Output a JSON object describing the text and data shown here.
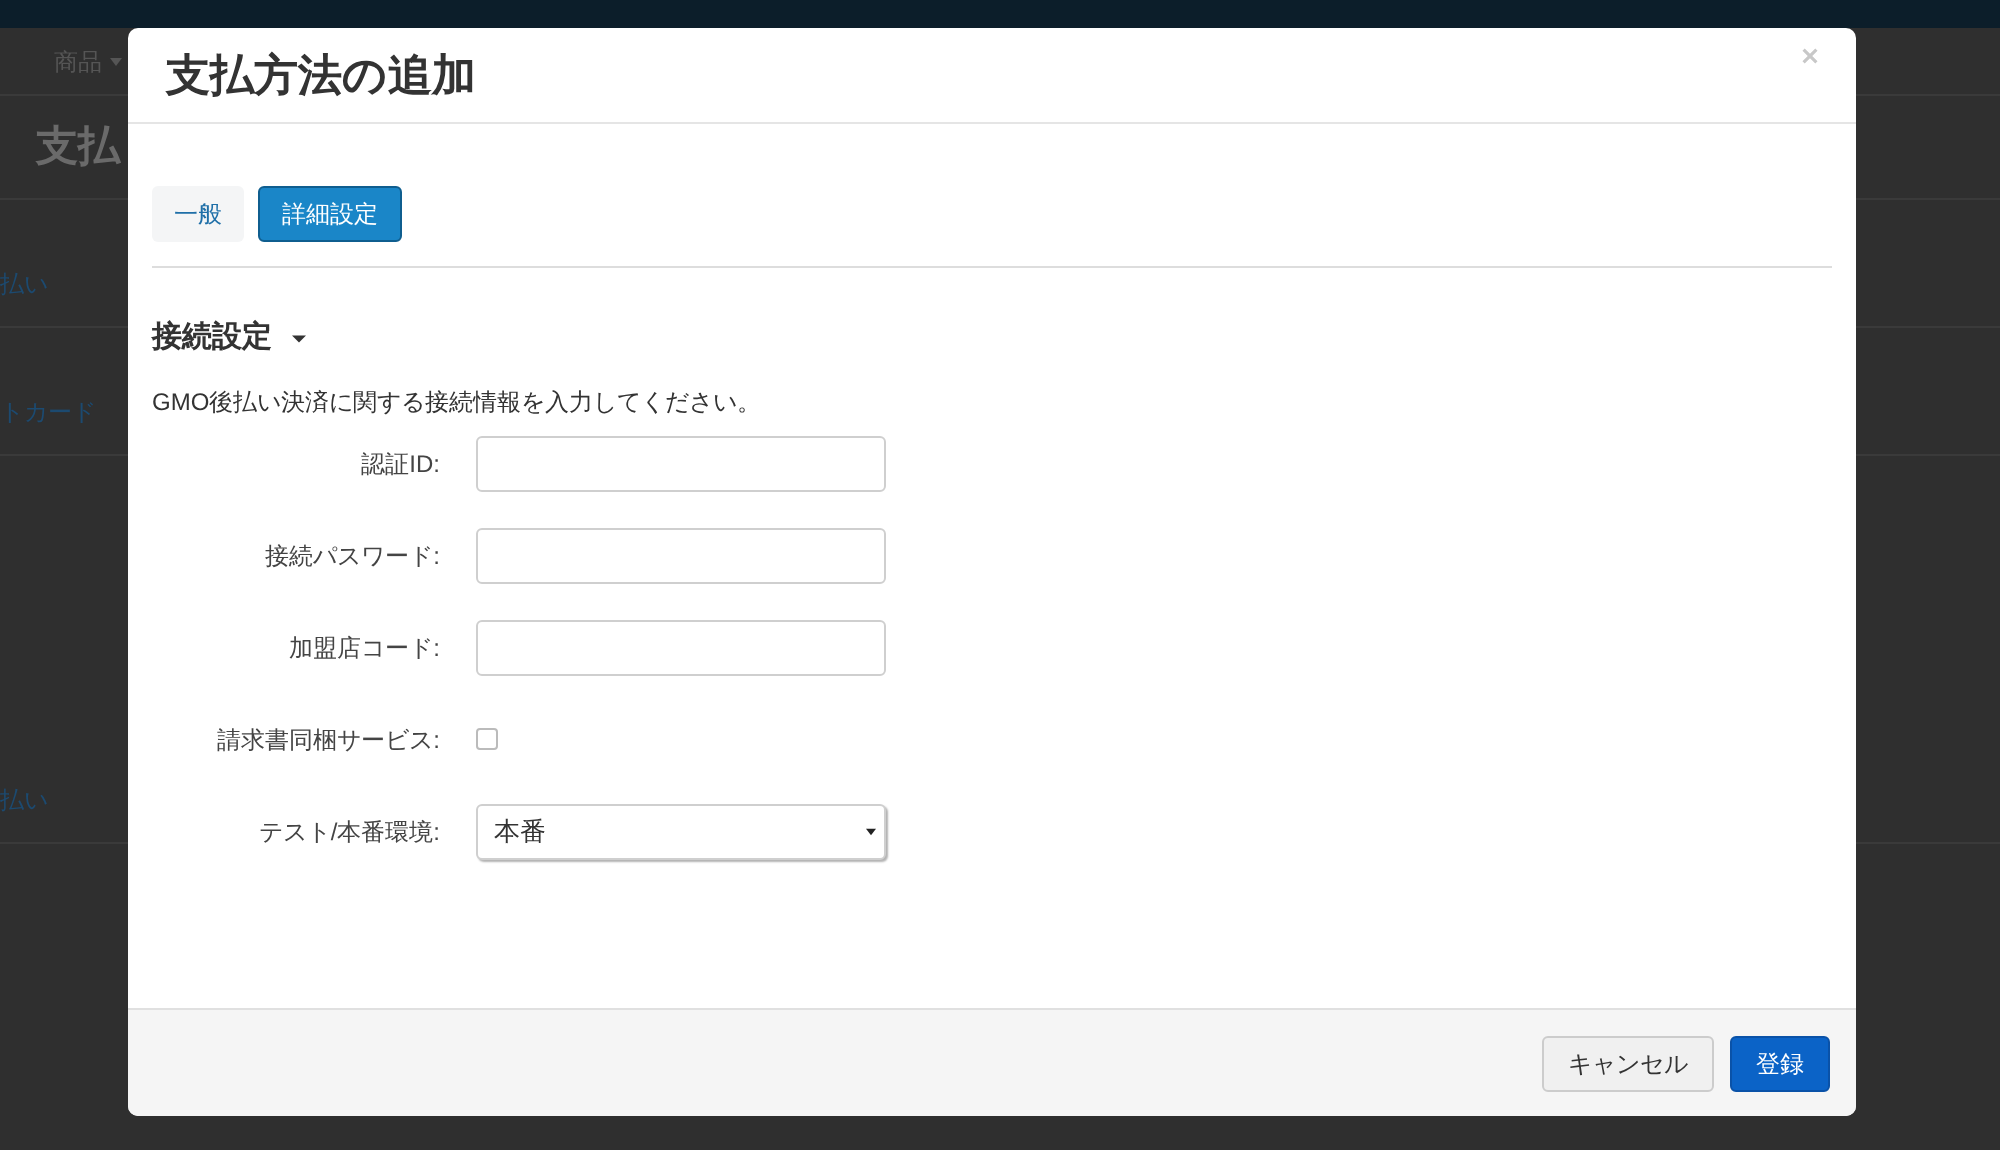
{
  "background": {
    "nav_item": "商品",
    "page_title": "支払",
    "list_items": [
      "払い",
      "トカード",
      "払い"
    ]
  },
  "dialog": {
    "title": "支払方法の追加",
    "tabs": [
      {
        "label": "一般",
        "selected": false
      },
      {
        "label": "詳細設定",
        "selected": true
      }
    ],
    "section": {
      "title": "接続設定",
      "expanded": true,
      "description": "GMO後払い決済に関する接続情報を入力してください。"
    },
    "fields": [
      {
        "kind": "text",
        "label": "認証ID:"
      },
      {
        "kind": "text",
        "label": "接続パスワード:"
      },
      {
        "kind": "text",
        "label": "加盟店コード:"
      },
      {
        "kind": "checkbox",
        "label": "請求書同梱サービス:",
        "checked": false
      },
      {
        "kind": "select",
        "label": "テスト/本番環境:",
        "value": "本番"
      }
    ],
    "buttons": [
      {
        "kind": "secondary",
        "label": "キャンセル"
      },
      {
        "kind": "primary",
        "label": "登録"
      }
    ]
  }
}
